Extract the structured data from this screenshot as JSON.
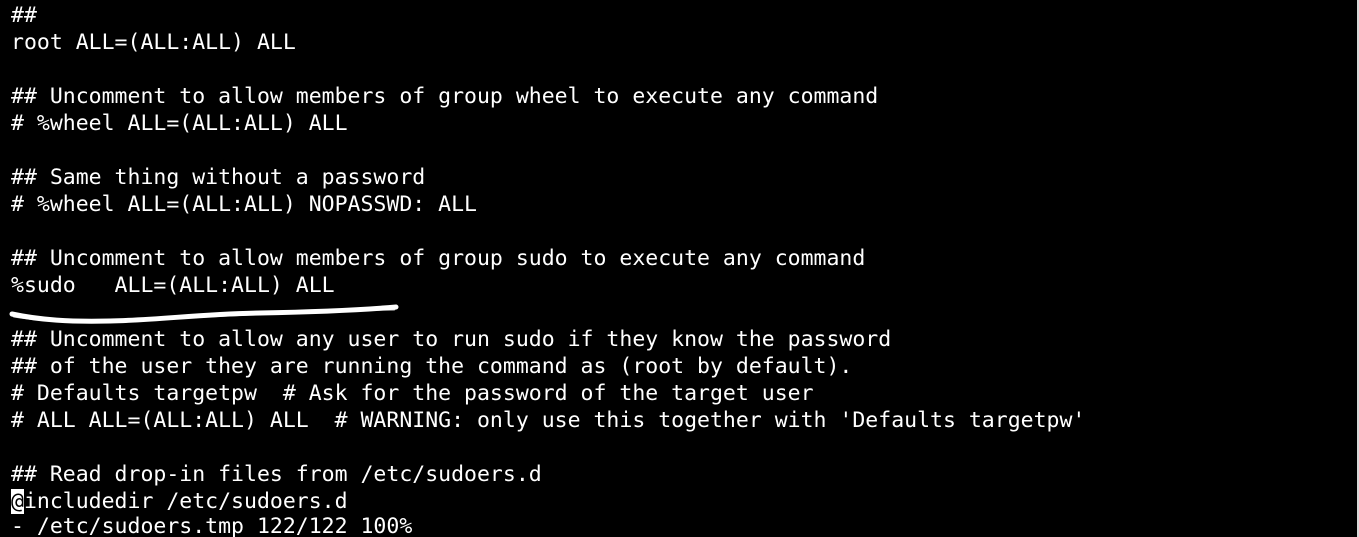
{
  "editor": {
    "lines": [
      "##",
      "root ALL=(ALL:ALL) ALL",
      "",
      "## Uncomment to allow members of group wheel to execute any command",
      "# %wheel ALL=(ALL:ALL) ALL",
      "",
      "## Same thing without a password",
      "# %wheel ALL=(ALL:ALL) NOPASSWD: ALL",
      "",
      "## Uncomment to allow members of group sudo to execute any command",
      "%sudo   ALL=(ALL:ALL) ALL",
      "",
      "## Uncomment to allow any user to run sudo if they know the password",
      "## of the user they are running the command as (root by default).",
      "# Defaults targetpw  # Ask for the password of the target user",
      "# ALL ALL=(ALL:ALL) ALL  # WARNING: only use this together with 'Defaults targetpw'",
      "",
      "## Read drop-in files from /etc/sudoers.d"
    ],
    "cursor_line": {
      "cursor_char": "@",
      "rest": "includedir /etc/sudoers.d"
    }
  },
  "status_bar": {
    "text": "- /etc/sudoers.tmp 122/122 100%"
  },
  "colors": {
    "background": "#000000",
    "foreground": "#ffffff",
    "annotation": "#ffffff"
  }
}
